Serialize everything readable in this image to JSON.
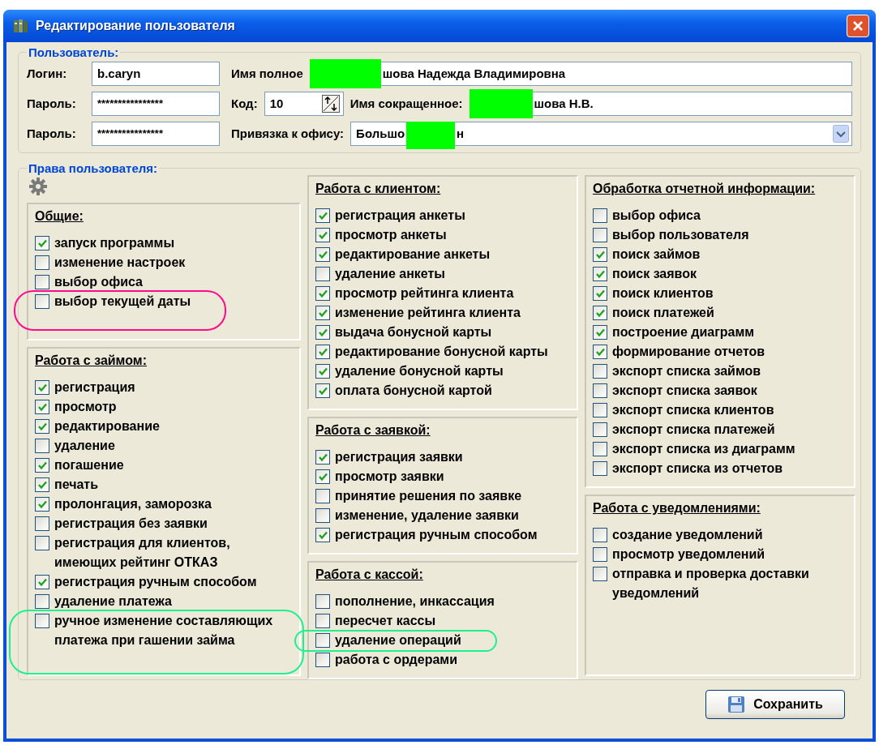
{
  "window": {
    "title": "Редактирование пользователя"
  },
  "user": {
    "legend": "Пользователь:",
    "login_label": "Логин:",
    "login": "b.caryn",
    "password_label": "Пароль:",
    "password": "****************",
    "password2_label": "Пароль:",
    "password2": "****************",
    "full_name_label": "Имя полное",
    "full_name": "шова Надежда Владимировна",
    "code_label": "Код:",
    "code": "10",
    "short_name_label": "Имя сокращенное:",
    "short_name": "шова Н.В.",
    "office_label": "Привязка к офису:",
    "office_start": "Большо",
    "office_end": "н"
  },
  "rights": {
    "legend": "Права пользователя:",
    "columns": [
      [
        {
          "title": "Общие:",
          "items": [
            {
              "label": "запуск программы",
              "checked": true
            },
            {
              "label": "изменение настроек",
              "checked": false
            },
            {
              "label": "выбор офиса",
              "checked": false
            },
            {
              "label": "выбор текущей даты",
              "checked": false
            }
          ]
        },
        {
          "title": "Работа с займом:",
          "items": [
            {
              "label": "регистрация",
              "checked": true
            },
            {
              "label": "просмотр",
              "checked": true
            },
            {
              "label": "редактирование",
              "checked": true
            },
            {
              "label": "удаление",
              "checked": false
            },
            {
              "label": "погашение",
              "checked": true
            },
            {
              "label": "печать",
              "checked": true
            },
            {
              "label": "пролонгация, заморозка",
              "checked": true
            },
            {
              "label": "регистрация без заявки",
              "checked": false
            },
            {
              "label": "регистрация для клиентов,\nимеющих рейтинг ОТКАЗ",
              "checked": false
            },
            {
              "label": "регистрация ручным способом",
              "checked": true
            },
            {
              "label": "удаление платежа",
              "checked": false
            },
            {
              "label": "ручное изменение составляющих\nплатежа при гашении займа",
              "checked": false
            }
          ]
        }
      ],
      [
        {
          "title": "Работа с клиентом:",
          "items": [
            {
              "label": "регистрация анкеты",
              "checked": true
            },
            {
              "label": "просмотр анкеты",
              "checked": true
            },
            {
              "label": "редактирование анкеты",
              "checked": true
            },
            {
              "label": "удаление анкеты",
              "checked": false
            },
            {
              "label": "просмотр рейтинга клиента",
              "checked": true
            },
            {
              "label": "изменение рейтинга клиента",
              "checked": true
            },
            {
              "label": "выдача бонусной карты",
              "checked": true
            },
            {
              "label": "редактирование бонусной карты",
              "checked": true
            },
            {
              "label": "удаление бонусной карты",
              "checked": true
            },
            {
              "label": "оплата бонусной картой",
              "checked": true
            }
          ]
        },
        {
          "title": "Работа с заявкой:",
          "items": [
            {
              "label": "регистрация заявки",
              "checked": true
            },
            {
              "label": "просмотр заявки",
              "checked": true
            },
            {
              "label": "принятие решения по заявке",
              "checked": false
            },
            {
              "label": "изменение, удаление заявки",
              "checked": false
            },
            {
              "label": "регистрация ручным способом",
              "checked": true
            }
          ]
        },
        {
          "title": "Работа с кассой:",
          "items": [
            {
              "label": "пополнение, инкассация",
              "checked": false
            },
            {
              "label": "пересчет кассы",
              "checked": false
            },
            {
              "label": "удаление операций",
              "checked": false
            },
            {
              "label": "работа с ордерами",
              "checked": false
            }
          ]
        }
      ],
      [
        {
          "title": "Обработка отчетной информации:",
          "items": [
            {
              "label": "выбор офиса",
              "checked": false
            },
            {
              "label": "выбор пользователя",
              "checked": false
            },
            {
              "label": "поиск займов",
              "checked": true
            },
            {
              "label": "поиск заявок",
              "checked": true
            },
            {
              "label": "поиск клиентов",
              "checked": true
            },
            {
              "label": "поиск платежей",
              "checked": true
            },
            {
              "label": "построение диаграмм",
              "checked": true
            },
            {
              "label": "формирование отчетов",
              "checked": true
            },
            {
              "label": "экспорт списка займов",
              "checked": false
            },
            {
              "label": "экспорт списка заявок",
              "checked": false
            },
            {
              "label": "экспорт списка клиентов",
              "checked": false
            },
            {
              "label": "экспорт списка платежей",
              "checked": false
            },
            {
              "label": "экспорт списка из диаграмм",
              "checked": false
            },
            {
              "label": "экспорт списка из отчетов",
              "checked": false
            }
          ]
        },
        {
          "title": "Работа с уведомлениями:",
          "items": [
            {
              "label": "создание уведомлений",
              "checked": false
            },
            {
              "label": "просмотр уведомлений",
              "checked": false
            },
            {
              "label": "отправка и проверка доставки\nуведомлений",
              "checked": false
            }
          ]
        }
      ]
    ]
  },
  "save_button": "Сохранить"
}
